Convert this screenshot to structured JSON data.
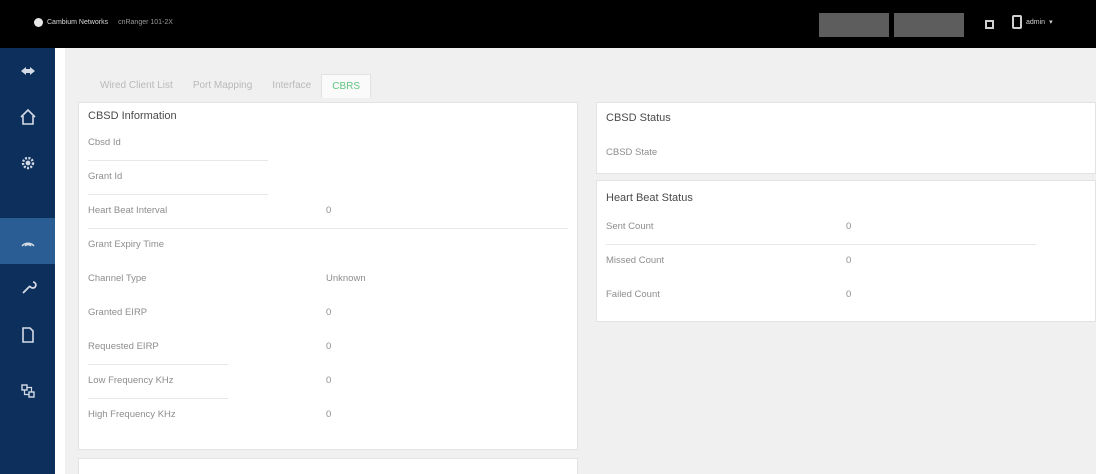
{
  "header": {
    "brand": "Cambium Networks",
    "device": "cnRanger 101-2X",
    "button_1": "",
    "button_2": "",
    "user": "admin"
  },
  "sidebar": {
    "items": [
      {
        "icon": "pin-icon",
        "active": false
      },
      {
        "icon": "home-icon",
        "active": false
      },
      {
        "icon": "gear-icon",
        "active": false
      },
      {
        "icon": "wireless-icon",
        "active": true
      },
      {
        "icon": "wrench-icon",
        "active": false
      },
      {
        "icon": "document-icon",
        "active": false
      },
      {
        "icon": "network-icon",
        "active": false
      }
    ]
  },
  "tabs": [
    {
      "label": "Wired Client List",
      "active": false
    },
    {
      "label": "Port Mapping",
      "active": false
    },
    {
      "label": "Interface",
      "active": false
    },
    {
      "label": "CBRS",
      "active": true
    }
  ],
  "cbsd_info": {
    "title": "CBSD Information",
    "rows": [
      {
        "label": "Cbsd Id",
        "value": ""
      },
      {
        "label": "Grant Id",
        "value": ""
      },
      {
        "label": "Heart Beat Interval",
        "value": "0"
      },
      {
        "label": "Grant Expiry Time",
        "value": ""
      },
      {
        "label": "Channel Type",
        "value": "Unknown"
      },
      {
        "label": "Granted EIRP",
        "value": "0"
      },
      {
        "label": "Requested EIRP",
        "value": "0"
      },
      {
        "label": "Low Frequency KHz",
        "value": "0"
      },
      {
        "label": "High Frequency KHz",
        "value": "0"
      }
    ]
  },
  "cbsd_status": {
    "title": "CBSD Status",
    "state_label": "CBSD State",
    "state_value": ""
  },
  "heartbeat_status": {
    "title": "Heart Beat Status",
    "rows": [
      {
        "label": "Sent Count",
        "value": "0"
      },
      {
        "label": "Missed Count",
        "value": "0"
      },
      {
        "label": "Failed Count",
        "value": "0"
      }
    ]
  },
  "colors": {
    "topbar": "#000000",
    "sidebar": "#0d2f5c",
    "sidebar_active": "#2a5d94",
    "accent": "#5fc57f"
  }
}
